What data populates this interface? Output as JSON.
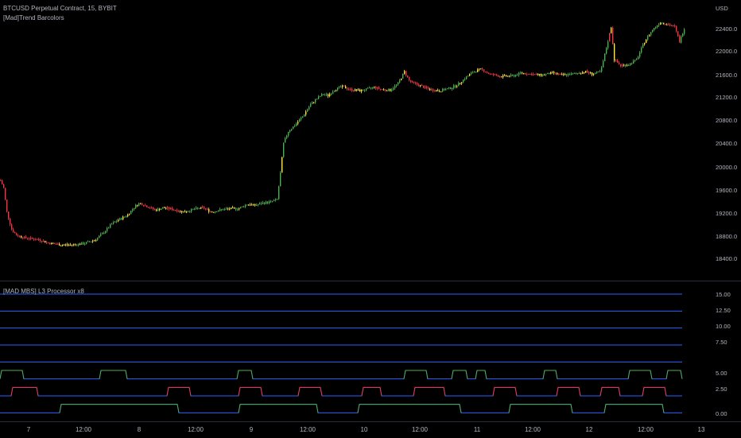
{
  "main": {
    "symbol_title": "BTCUSD Perpetual Contract, 15, BYBIT",
    "indicator_title": "[Mad]Trend Barcolors"
  },
  "oscillator": {
    "title": "[MAD MBS] L3 Processor x8"
  },
  "price_axis": {
    "currency": "USD",
    "labels": [
      "22400.0",
      "22000.0",
      "21600.0",
      "21200.0",
      "20800.0",
      "20400.0",
      "20000.0",
      "19600.0",
      "19200.0",
      "18800.0",
      "18400.0"
    ]
  },
  "osc_axis": {
    "labels": [
      "15.00",
      "12.50",
      "10.00",
      "7.50",
      "5.00",
      "2.50",
      "0.00"
    ]
  },
  "time_axis": {
    "labels": [
      "7",
      "12:00",
      "8",
      "12:00",
      "9",
      "12:00",
      "10",
      "12:00",
      "11",
      "12:00",
      "12",
      "12:00",
      "13"
    ]
  },
  "colors": {
    "background": "#000000",
    "bull": "#4caf50",
    "bear": "#f23645",
    "neutral": "#ffeb3b",
    "osc_line": "#2962ff",
    "axis_text": "#b2b5be"
  },
  "chart_data": {
    "type": "line",
    "title": "BTCUSD Perpetual Contract, 15, BYBIT",
    "price_path": [
      [
        0,
        19780
      ],
      [
        4,
        19650
      ],
      [
        8,
        19250
      ],
      [
        14,
        18960
      ],
      [
        20,
        18860
      ],
      [
        30,
        18820
      ],
      [
        40,
        18800
      ],
      [
        50,
        18780
      ],
      [
        60,
        18730
      ],
      [
        75,
        18700
      ],
      [
        90,
        18700
      ],
      [
        105,
        18720
      ],
      [
        120,
        18790
      ],
      [
        130,
        18910
      ],
      [
        140,
        19050
      ],
      [
        150,
        19130
      ],
      [
        160,
        19200
      ],
      [
        168,
        19330
      ],
      [
        175,
        19400
      ],
      [
        185,
        19340
      ],
      [
        195,
        19280
      ],
      [
        205,
        19320
      ],
      [
        215,
        19300
      ],
      [
        230,
        19250
      ],
      [
        245,
        19300
      ],
      [
        255,
        19320
      ],
      [
        265,
        19250
      ],
      [
        275,
        19280
      ],
      [
        285,
        19300
      ],
      [
        300,
        19310
      ],
      [
        310,
        19380
      ],
      [
        320,
        19360
      ],
      [
        330,
        19400
      ],
      [
        340,
        19420
      ],
      [
        348,
        19460
      ],
      [
        352,
        19900
      ],
      [
        356,
        20400
      ],
      [
        362,
        20600
      ],
      [
        370,
        20700
      ],
      [
        380,
        20850
      ],
      [
        390,
        21050
      ],
      [
        398,
        21150
      ],
      [
        405,
        21220
      ],
      [
        412,
        21200
      ],
      [
        420,
        21300
      ],
      [
        430,
        21350
      ],
      [
        440,
        21300
      ],
      [
        452,
        21280
      ],
      [
        460,
        21300
      ],
      [
        470,
        21340
      ],
      [
        480,
        21300
      ],
      [
        490,
        21290
      ],
      [
        500,
        21400
      ],
      [
        508,
        21600
      ],
      [
        515,
        21430
      ],
      [
        525,
        21380
      ],
      [
        540,
        21300
      ],
      [
        552,
        21280
      ],
      [
        565,
        21320
      ],
      [
        575,
        21380
      ],
      [
        585,
        21500
      ],
      [
        595,
        21600
      ],
      [
        605,
        21640
      ],
      [
        615,
        21560
      ],
      [
        630,
        21520
      ],
      [
        645,
        21530
      ],
      [
        655,
        21580
      ],
      [
        665,
        21560
      ],
      [
        680,
        21540
      ],
      [
        695,
        21580
      ],
      [
        705,
        21540
      ],
      [
        720,
        21560
      ],
      [
        735,
        21600
      ],
      [
        745,
        21560
      ],
      [
        755,
        21600
      ],
      [
        762,
        22000
      ],
      [
        768,
        22350
      ],
      [
        772,
        21800
      ],
      [
        780,
        21700
      ],
      [
        790,
        21720
      ],
      [
        800,
        21800
      ],
      [
        810,
        22100
      ],
      [
        820,
        22300
      ],
      [
        830,
        22430
      ],
      [
        840,
        22390
      ],
      [
        848,
        22350
      ],
      [
        854,
        22100
      ],
      [
        860,
        22330
      ]
    ],
    "ylim": [
      18100,
      22800
    ],
    "oscillator_levels": [
      15.0,
      13.0,
      11.0,
      9.0,
      7.0
    ],
    "oscillator_active_lines": [
      {
        "base": 5.0,
        "segments": [
          [
            0,
            30
          ],
          [
            125,
            160
          ],
          [
            298,
            318
          ],
          [
            508,
            538
          ],
          [
            568,
            588
          ],
          [
            598,
            612
          ],
          [
            683,
            701
          ],
          [
            790,
            820
          ],
          [
            838,
            858
          ]
        ]
      },
      {
        "base": 3.0,
        "segments": [
          [
            14,
            48
          ],
          [
            210,
            240
          ],
          [
            300,
            330
          ],
          [
            375,
            405
          ],
          [
            455,
            480
          ],
          [
            520,
            560
          ],
          [
            620,
            650
          ],
          [
            700,
            730
          ],
          [
            755,
            780
          ],
          [
            808,
            838
          ]
        ]
      },
      {
        "base": 1.0,
        "segments": [
          [
            75,
            225
          ],
          [
            300,
            400
          ],
          [
            450,
            580
          ],
          [
            640,
            720
          ],
          [
            760,
            835
          ]
        ]
      }
    ],
    "ylim_oscillator": [
      0,
      16.5
    ]
  }
}
